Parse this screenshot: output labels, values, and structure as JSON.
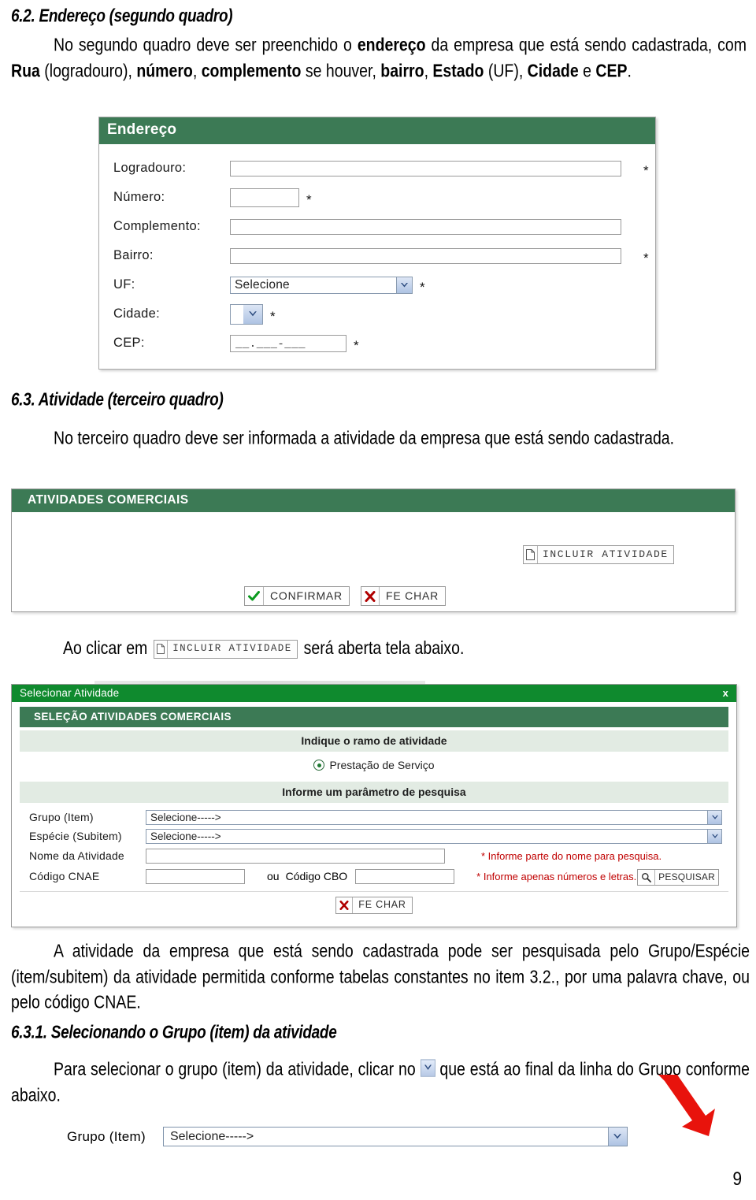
{
  "section_62": {
    "heading": "6.2. Endereço (segundo quadro)",
    "paragraph_part1": "No segundo quadro deve ser preenchido o ",
    "b_endereco": "endereço",
    "paragraph_part2": " da empresa que está sendo cadastrada, com ",
    "b_rua": "Rua",
    "paragraph_part3": " (logradouro), ",
    "b_numero": "número",
    "paragraph_part4": ", ",
    "b_complemento": "complemento",
    "paragraph_part5": " se houver, ",
    "b_bairro": "bairro",
    "paragraph_part6": ", ",
    "b_estado": "Estado",
    "paragraph_part7": " (UF), ",
    "b_cidade": "Cidade",
    "paragraph_part8": " e ",
    "b_cep": "CEP",
    "paragraph_part9": "."
  },
  "endereco_form": {
    "title": "Endereço",
    "fields": [
      {
        "label": "Logradouro:",
        "type": "text",
        "value": "",
        "required_mark": "*"
      },
      {
        "label": "Número:",
        "type": "text-short",
        "value": "",
        "required_mark": "*"
      },
      {
        "label": "Complemento:",
        "type": "text",
        "value": "",
        "required_mark": ""
      },
      {
        "label": "Bairro:",
        "type": "text",
        "value": "",
        "required_mark": "*"
      },
      {
        "label": "UF:",
        "type": "select",
        "value": "Selecione",
        "required_mark": "*"
      },
      {
        "label": "Cidade:",
        "type": "select-small",
        "value": "",
        "required_mark": "*"
      },
      {
        "label": "CEP:",
        "type": "mask",
        "value": "__.___-___",
        "required_mark": "*"
      }
    ]
  },
  "section_63": {
    "heading": "6.3. Atividade (terceiro quadro)",
    "paragraph": "No terceiro quadro deve ser informada a atividade da empresa que está sendo cadastrada."
  },
  "atividades_panel": {
    "title": "ATIVIDADES COMERCIAIS",
    "incluir_label": "INCLUIR ATIVIDADE",
    "confirmar_label": "CONFIRMAR",
    "fechar_label": "FE CHAR"
  },
  "clicar_line": {
    "before": "Ao clicar em",
    "button_label": "INCLUIR ATIVIDADE",
    "after": "será aberta tela abaixo."
  },
  "dialog": {
    "window_title": "Selecionar Atividade",
    "close_label": "x",
    "section_title": "SELEÇÃO ATIVIDADES COMERCIAIS",
    "band_ramo": "Indique o ramo de atividade",
    "radio_label": "Prestação de Serviço",
    "band_parametro": "Informe um parâmetro de pesquisa",
    "rows": [
      {
        "label": "Grupo (Item)",
        "value": "Selecione----->"
      },
      {
        "label": "Espécie (Subitem)",
        "value": "Selecione----->"
      }
    ],
    "nome_atividade_label": "Nome da Atividade",
    "nome_atividade_value": "",
    "nome_atividade_hint": "* Informe parte do nome para pesquisa.",
    "codigo_cnae_label": "Código CNAE",
    "codigo_cnae_value": "",
    "ou_label": "ou",
    "codigo_cbo_label": "Código CBO",
    "codigo_cbo_value": "",
    "codigo_hint": "* Informe apenas números e letras.",
    "pesquisar_label": "PESQUISAR",
    "fechar_label": "FE CHAR"
  },
  "paragraph_after_dialog": {
    "text": "A atividade da empresa que está sendo cadastrada pode ser pesquisada pelo Grupo/Espécie (item/subitem) da atividade permitida conforme tabelas constantes no item 3.2., por uma palavra chave, ou pelo código CNAE."
  },
  "section_631": {
    "heading": "6.3.1. Selecionando o Grupo (item) da atividade",
    "paragraph_part1": "Para selecionar o grupo (item) da atividade, clicar no ",
    "paragraph_part2": " que está ao final da linha do Grupo conforme abaixo."
  },
  "grupo_bottom": {
    "label": "Grupo (Item)",
    "value": "Selecione----->"
  },
  "footer": {
    "page_number": "9"
  },
  "colors": {
    "panel_green": "#3c7a55",
    "dialog_green": "#0f8a2e",
    "band_green": "#e2ebe3",
    "hint_red": "#c00000",
    "arrow_red": "#e8130c"
  }
}
